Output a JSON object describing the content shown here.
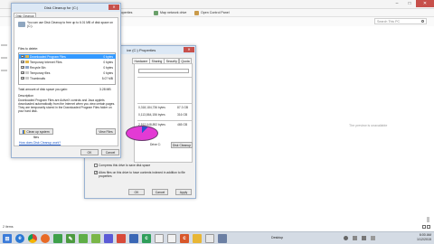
{
  "explorer": {
    "ribbon": {
      "properties": "Properties",
      "map_drive": "Map network drive",
      "open_panel": "Open Control Panel"
    },
    "search_placeholder": "Search This PC",
    "preview": "The preview is unavailable",
    "status": "2 items"
  },
  "disk_cleanup": {
    "title": "Disk Cleanup for (C:)",
    "tab": "Disk Cleanup",
    "intro": "You can use Disk Cleanup to free up to 6.01 MB of disk space on (C:).",
    "files_label": "Files to delete:",
    "files": [
      {
        "name": "Downloaded Program Files",
        "size": "0 bytes",
        "checked": true,
        "selected": true
      },
      {
        "name": "Temporary Internet Files",
        "size": "0 bytes",
        "checked": true,
        "selected": false
      },
      {
        "name": "Recycle Bin",
        "size": "0 bytes",
        "checked": true,
        "selected": false
      },
      {
        "name": "Temporary files",
        "size": "0 bytes",
        "checked": true,
        "selected": false
      },
      {
        "name": "Thumbnails",
        "size": "5.07 MB",
        "checked": true,
        "selected": false
      }
    ],
    "total_label": "Total amount of disk space you gain:",
    "total_value": "3.28 MB",
    "description_label": "Description",
    "description": "Downloaded Program Files are ActiveX controls and Java applets downloaded automatically from the Internet when you view certain pages. They are temporarily stored in the Downloaded Program Files folder on your hard disk.",
    "cleanup_system_label": "Clean up system files",
    "view_files_label": "View Files",
    "how_link": "How does Disk Cleanup work?",
    "ok_label": "OK",
    "cancel_label": "Cancel"
  },
  "properties": {
    "title": "ive (C:) Properties",
    "tabs": [
      "Hardware",
      "Sharing",
      "Security",
      "Quota"
    ],
    "used_bytes": "0,318,184,736 bytes",
    "used_gb": "87.3 GB",
    "free_bytes": "0,113,864,156 bytes",
    "free_gb": "316 GB",
    "capacity_bytes": "2,512,048,892 bytes",
    "capacity_gb": "465 GB",
    "drive_label": "Drive C:",
    "disk_cleanup_button": "Disk Cleanup",
    "compress_label": "Compress this drive to save disk space",
    "index_label": "Allow files on this drive to have contents indexed in addition to file properties",
    "ok_label": "OK",
    "cancel_label": "Cancel",
    "apply_label": "Apply",
    "pie_used_fraction": 0.12,
    "colors": {
      "used": "#2b4fd1",
      "free": "#e33ad4"
    }
  },
  "taskbar": {
    "desktop_label": "Desktop",
    "time": "6:00 AM",
    "date": "1/12/2015"
  }
}
